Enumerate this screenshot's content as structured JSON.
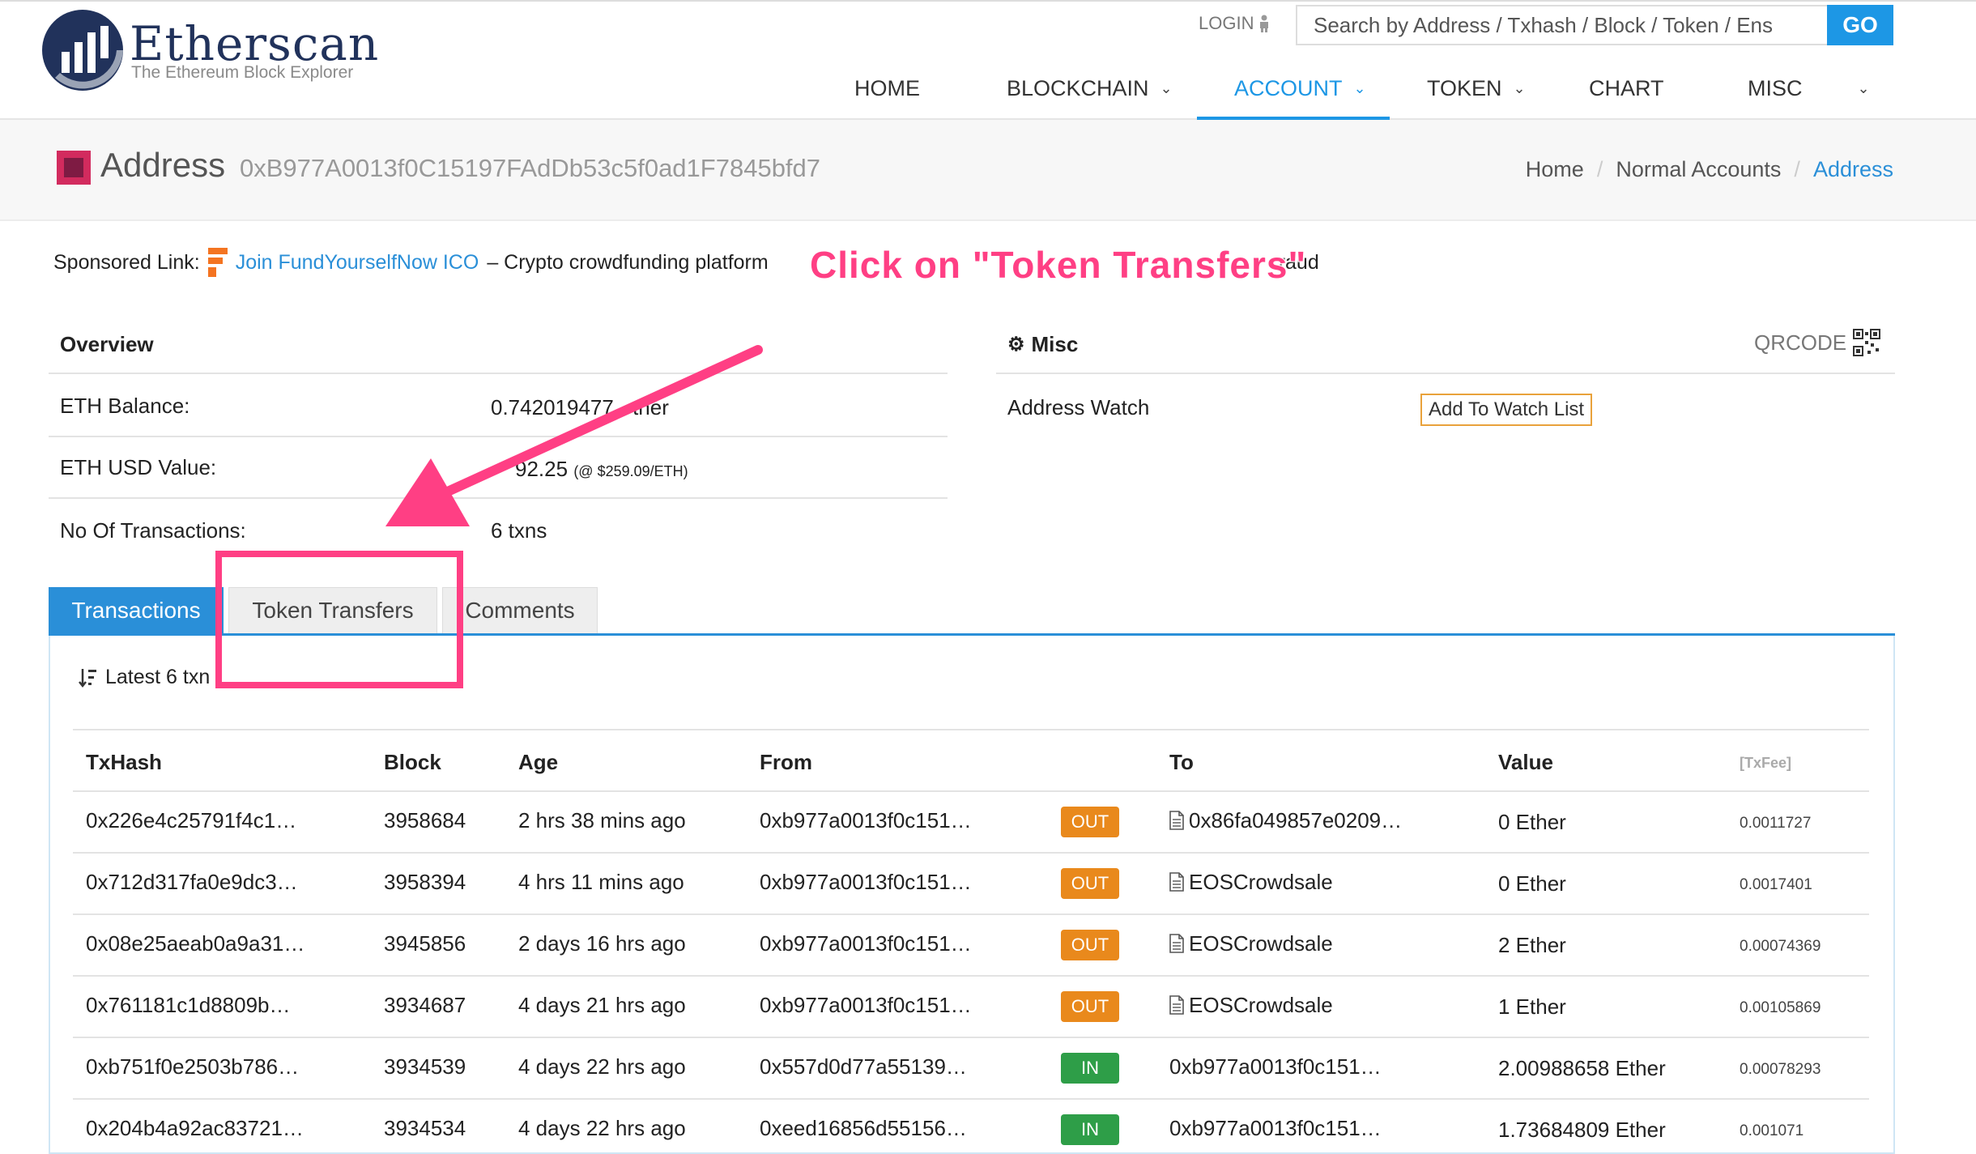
{
  "header": {
    "logo_name": "Etherscan",
    "logo_tagline": "The Ethereum Block Explorer",
    "login_label": "LOGIN",
    "search_placeholder": "Search by Address / Txhash / Block / Token / Ens",
    "search_go": "GO",
    "nav": {
      "home": "HOME",
      "blockchain": "BLOCKCHAIN",
      "account": "ACCOUNT",
      "token": "TOKEN",
      "chart": "CHART",
      "misc": "MISC"
    },
    "accent_color": "#1d97e5"
  },
  "address_header": {
    "label": "Address",
    "hash": "0xB977A0013f0C15197FAdDb53c5f0ad1F7845bfd7",
    "breadcrumb": [
      "Home",
      "Normal Accounts",
      "Address"
    ]
  },
  "sponsored": {
    "prefix": "Sponsored Link:",
    "link_text": "Join FundYourselfNow ICO",
    "description_visible": "– Crypto crowdfunding platform",
    "description_tail": "raud"
  },
  "overview": {
    "title": "Overview",
    "rows": [
      {
        "label": "ETH Balance:",
        "value": "0.742019477",
        "suffix": "ther"
      },
      {
        "label": "ETH USD Value:",
        "value": "92.25",
        "note": "(@ $259.09/ETH)"
      },
      {
        "label": "No Of Transactions:",
        "value": "6 txns"
      }
    ]
  },
  "misc": {
    "title": "Misc",
    "qrcode_label": "QRCODE",
    "address_watch_label": "Address Watch",
    "watch_button": "Add To Watch List"
  },
  "tabs": [
    "Transactions",
    "Token Transfers",
    "Comments"
  ],
  "latest_label": "Latest 6 txn",
  "table": {
    "headers": [
      "TxHash",
      "Block",
      "Age",
      "From",
      "To",
      "Value",
      "[TxFee]"
    ],
    "rows": [
      {
        "hash": "0x226e4c25791f4c1…",
        "block": "3958684",
        "age": "2 hrs 38 mins ago",
        "from": "0xb977a0013f0c151…",
        "dir": "OUT",
        "to": "0x86fa049857e0209…",
        "value": "0 Ether",
        "fee": "0.0011727"
      },
      {
        "hash": "0x712d317fa0e9dc3…",
        "block": "3958394",
        "age": "4 hrs 11 mins ago",
        "from": "0xb977a0013f0c151…",
        "dir": "OUT",
        "to": "EOSCrowdsale",
        "value": "0 Ether",
        "fee": "0.0017401"
      },
      {
        "hash": "0x08e25aeab0a9a31…",
        "block": "3945856",
        "age": "2 days 16 hrs ago",
        "from": "0xb977a0013f0c151…",
        "dir": "OUT",
        "to": "EOSCrowdsale",
        "value": "2 Ether",
        "fee": "0.00074369"
      },
      {
        "hash": "0x761181c1d8809b…",
        "block": "3934687",
        "age": "4 days 21 hrs ago",
        "from": "0xb977a0013f0c151…",
        "dir": "OUT",
        "to": "EOSCrowdsale",
        "value": "1 Ether",
        "fee": "0.00105869"
      },
      {
        "hash": "0xb751f0e2503b786…",
        "block": "3934539",
        "age": "4 days 22 hrs ago",
        "from": "0x557d0d77a55139…",
        "dir": "IN",
        "to": "0xb977a0013f0c151…",
        "value": "2.00988658 Ether",
        "fee": "0.00078293"
      },
      {
        "hash": "0x204b4a92ac83721…",
        "block": "3934534",
        "age": "4 days 22 hrs ago",
        "from": "0xeed16856d55156…",
        "dir": "IN",
        "to": "0xb977a0013f0c151…",
        "value": "1.73684809 Ether",
        "fee": "0.001071"
      }
    ]
  },
  "annotation": {
    "text": "Click on \"Token Transfers\"",
    "color": "#ff3f84"
  }
}
